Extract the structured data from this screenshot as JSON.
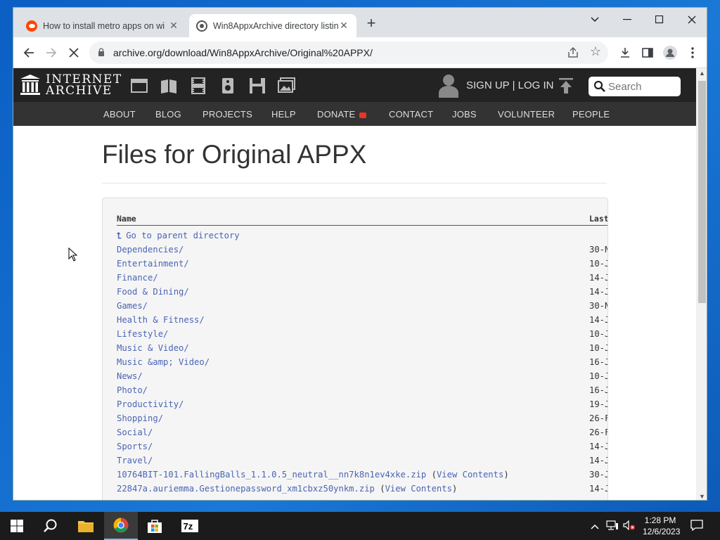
{
  "browser": {
    "tabs": [
      {
        "title": "How to install metro apps on wi",
        "active": false
      },
      {
        "title": "Win8AppxArchive directory listin",
        "active": true
      }
    ],
    "url": "archive.org/download/Win8AppxArchive/Original%20APPX/"
  },
  "ia": {
    "logo_line1": "INTERNET",
    "logo_line2": "ARCHIVE",
    "signup_label": "SIGN UP | LOG IN",
    "search_placeholder": "Search",
    "nav": [
      "ABOUT",
      "BLOG",
      "PROJECTS",
      "HELP",
      "DONATE",
      "CONTACT",
      "JOBS",
      "VOLUNTEER",
      "PEOPLE"
    ]
  },
  "page": {
    "title": "Files for Original APPX",
    "col_name": "Name",
    "col_last": "Last",
    "parent_label": "Go to parent directory",
    "rows": [
      {
        "name": "Dependencies/",
        "date": "30-N"
      },
      {
        "name": "Entertainment/",
        "date": "10-J"
      },
      {
        "name": "Finance/",
        "date": "14-J"
      },
      {
        "name": "Food & Dining/",
        "date": "14-J"
      },
      {
        "name": "Games/",
        "date": "30-N"
      },
      {
        "name": "Health & Fitness/",
        "date": "14-J"
      },
      {
        "name": "Lifestyle/",
        "date": "10-J"
      },
      {
        "name": "Music & Video/",
        "date": "10-J"
      },
      {
        "name": "Music &amp; Video/",
        "date": "16-J"
      },
      {
        "name": "News/",
        "date": "10-J"
      },
      {
        "name": "Photo/",
        "date": "16-J"
      },
      {
        "name": "Productivity/",
        "date": "19-J"
      },
      {
        "name": "Shopping/",
        "date": "26-F"
      },
      {
        "name": "Social/",
        "date": "26-F"
      },
      {
        "name": "Sports/",
        "date": "14-J"
      },
      {
        "name": "Travel/",
        "date": "14-J"
      },
      {
        "name": "10764BIT-101.FallingBalls_1.1.0.5_neutral__nn7k8n1ev4xke.zip",
        "view": "View Contents",
        "date": "30-J"
      },
      {
        "name": "22847a.auriemma.Gestionepassword_xm1cbxz50ynkm.zip",
        "view": "View Contents",
        "date": "14-J"
      }
    ]
  },
  "taskbar": {
    "time": "1:28 PM",
    "date": "12/6/2023"
  }
}
